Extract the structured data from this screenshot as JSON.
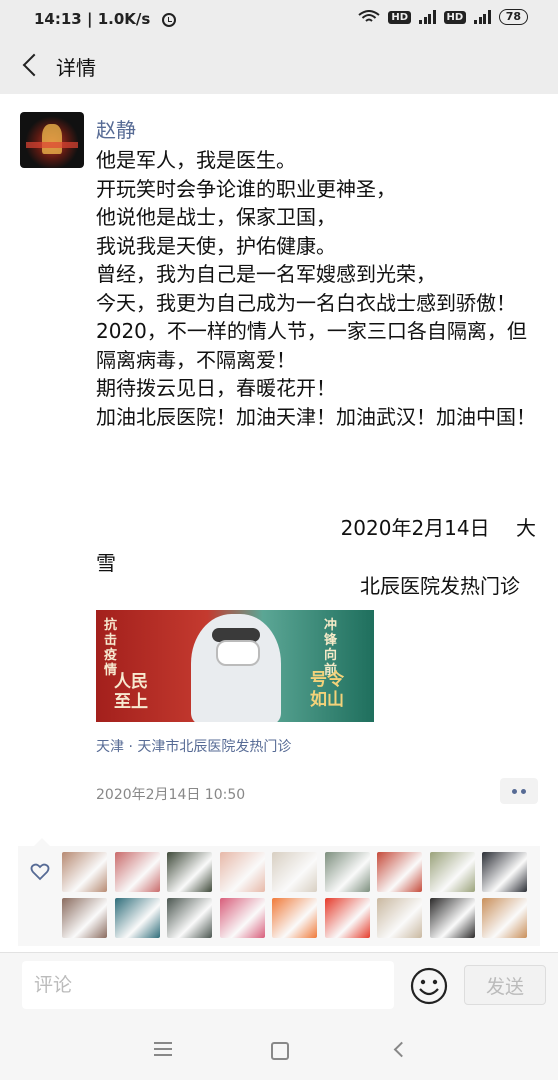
{
  "status_bar": {
    "time": "14:13",
    "speed": "1.0K/s",
    "hd1": "HD",
    "hd2": "HD",
    "battery": "78"
  },
  "header": {
    "title": "详情"
  },
  "post": {
    "author": "赵静",
    "lines": [
      "他是军人，我是医生。",
      "开玩笑时会争论谁的职业更神圣，",
      "他说他是战士，保家卫国，",
      "我说我是天使，护佑健康。",
      "曾经，我为自己是一名军嫂感到光荣，",
      "今天，我更为自己成为一名白衣战士感到骄傲！",
      "2020，不一样的情人节，一家三口各自隔离，但隔离病毒，不隔离爱！",
      "期待拨云见日，春暖花开！",
      "加油北辰医院！加油天津！加油武汉！加油中国！"
    ],
    "date_line": "2020年2月14日　 大",
    "date_line_2": "雪",
    "signature": "北辰医院发热门诊",
    "image": {
      "left_small": "抗击疫情",
      "left_big": "人民至上",
      "right_small": "冲锋向前",
      "right_big": "号令如山"
    },
    "location": "天津 · 天津市北辰医院发热门诊",
    "timestamp": "2020年2月14日 10:50"
  },
  "likes": {
    "colors": [
      "#b78a72",
      "#c96b6b",
      "#3f4a3a",
      "#e7b8a8",
      "#d8cfc2",
      "#7d8f7e",
      "#c54a3a",
      "#9aa27a",
      "#2c2f36",
      "#8a6b5e",
      "#2f6d7a",
      "#4b5650",
      "#d85d7a",
      "#f07a3a",
      "#e53b2b",
      "#c9b8a0",
      "#2b2a2a",
      "#c98f5a"
    ]
  },
  "composer": {
    "placeholder": "评论",
    "send_label": "发送"
  },
  "colors": {
    "link": "#576b95",
    "background": "#ededed"
  }
}
